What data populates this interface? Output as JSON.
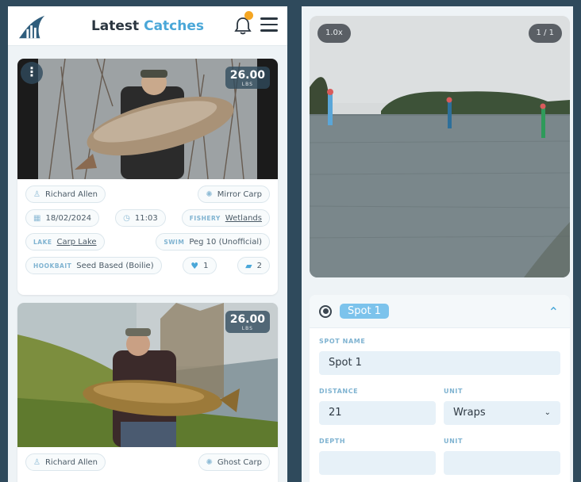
{
  "header": {
    "title_main": "Latest",
    "title_accent": "Catches"
  },
  "catches": [
    {
      "weight": "26.00",
      "weight_unit": "LBS",
      "angler": "Richard Allen",
      "species": "Mirror Carp",
      "date": "18/02/2024",
      "time": "11:03",
      "fishery_label": "FISHERY",
      "fishery": "Wetlands",
      "lake_label": "LAKE",
      "lake": "Carp Lake",
      "swim_label": "SWIM",
      "swim": "Peg 10 (Unofficial)",
      "hookbait_label": "HOOKBAIT",
      "hookbait": "Seed Based (Boilie)",
      "likes": "1",
      "comments": "2"
    },
    {
      "weight": "26.00",
      "weight_unit": "LBS",
      "angler": "Richard Allen",
      "species": "Ghost Carp"
    }
  ],
  "viewer": {
    "zoom": "1.0x",
    "counter": "1 / 1"
  },
  "spot": {
    "title": "Spot 1",
    "spot_name_label": "SPOT NAME",
    "spot_name": "Spot 1",
    "distance_label": "DISTANCE",
    "distance": "21",
    "unit_label": "UNIT",
    "unit": "Wraps",
    "depth_label": "DEPTH",
    "depth_unit_label": "UNIT"
  },
  "colors": {
    "accent": "#4aa7d8",
    "badge": "#f5a623",
    "frame": "#2f4a5c"
  }
}
